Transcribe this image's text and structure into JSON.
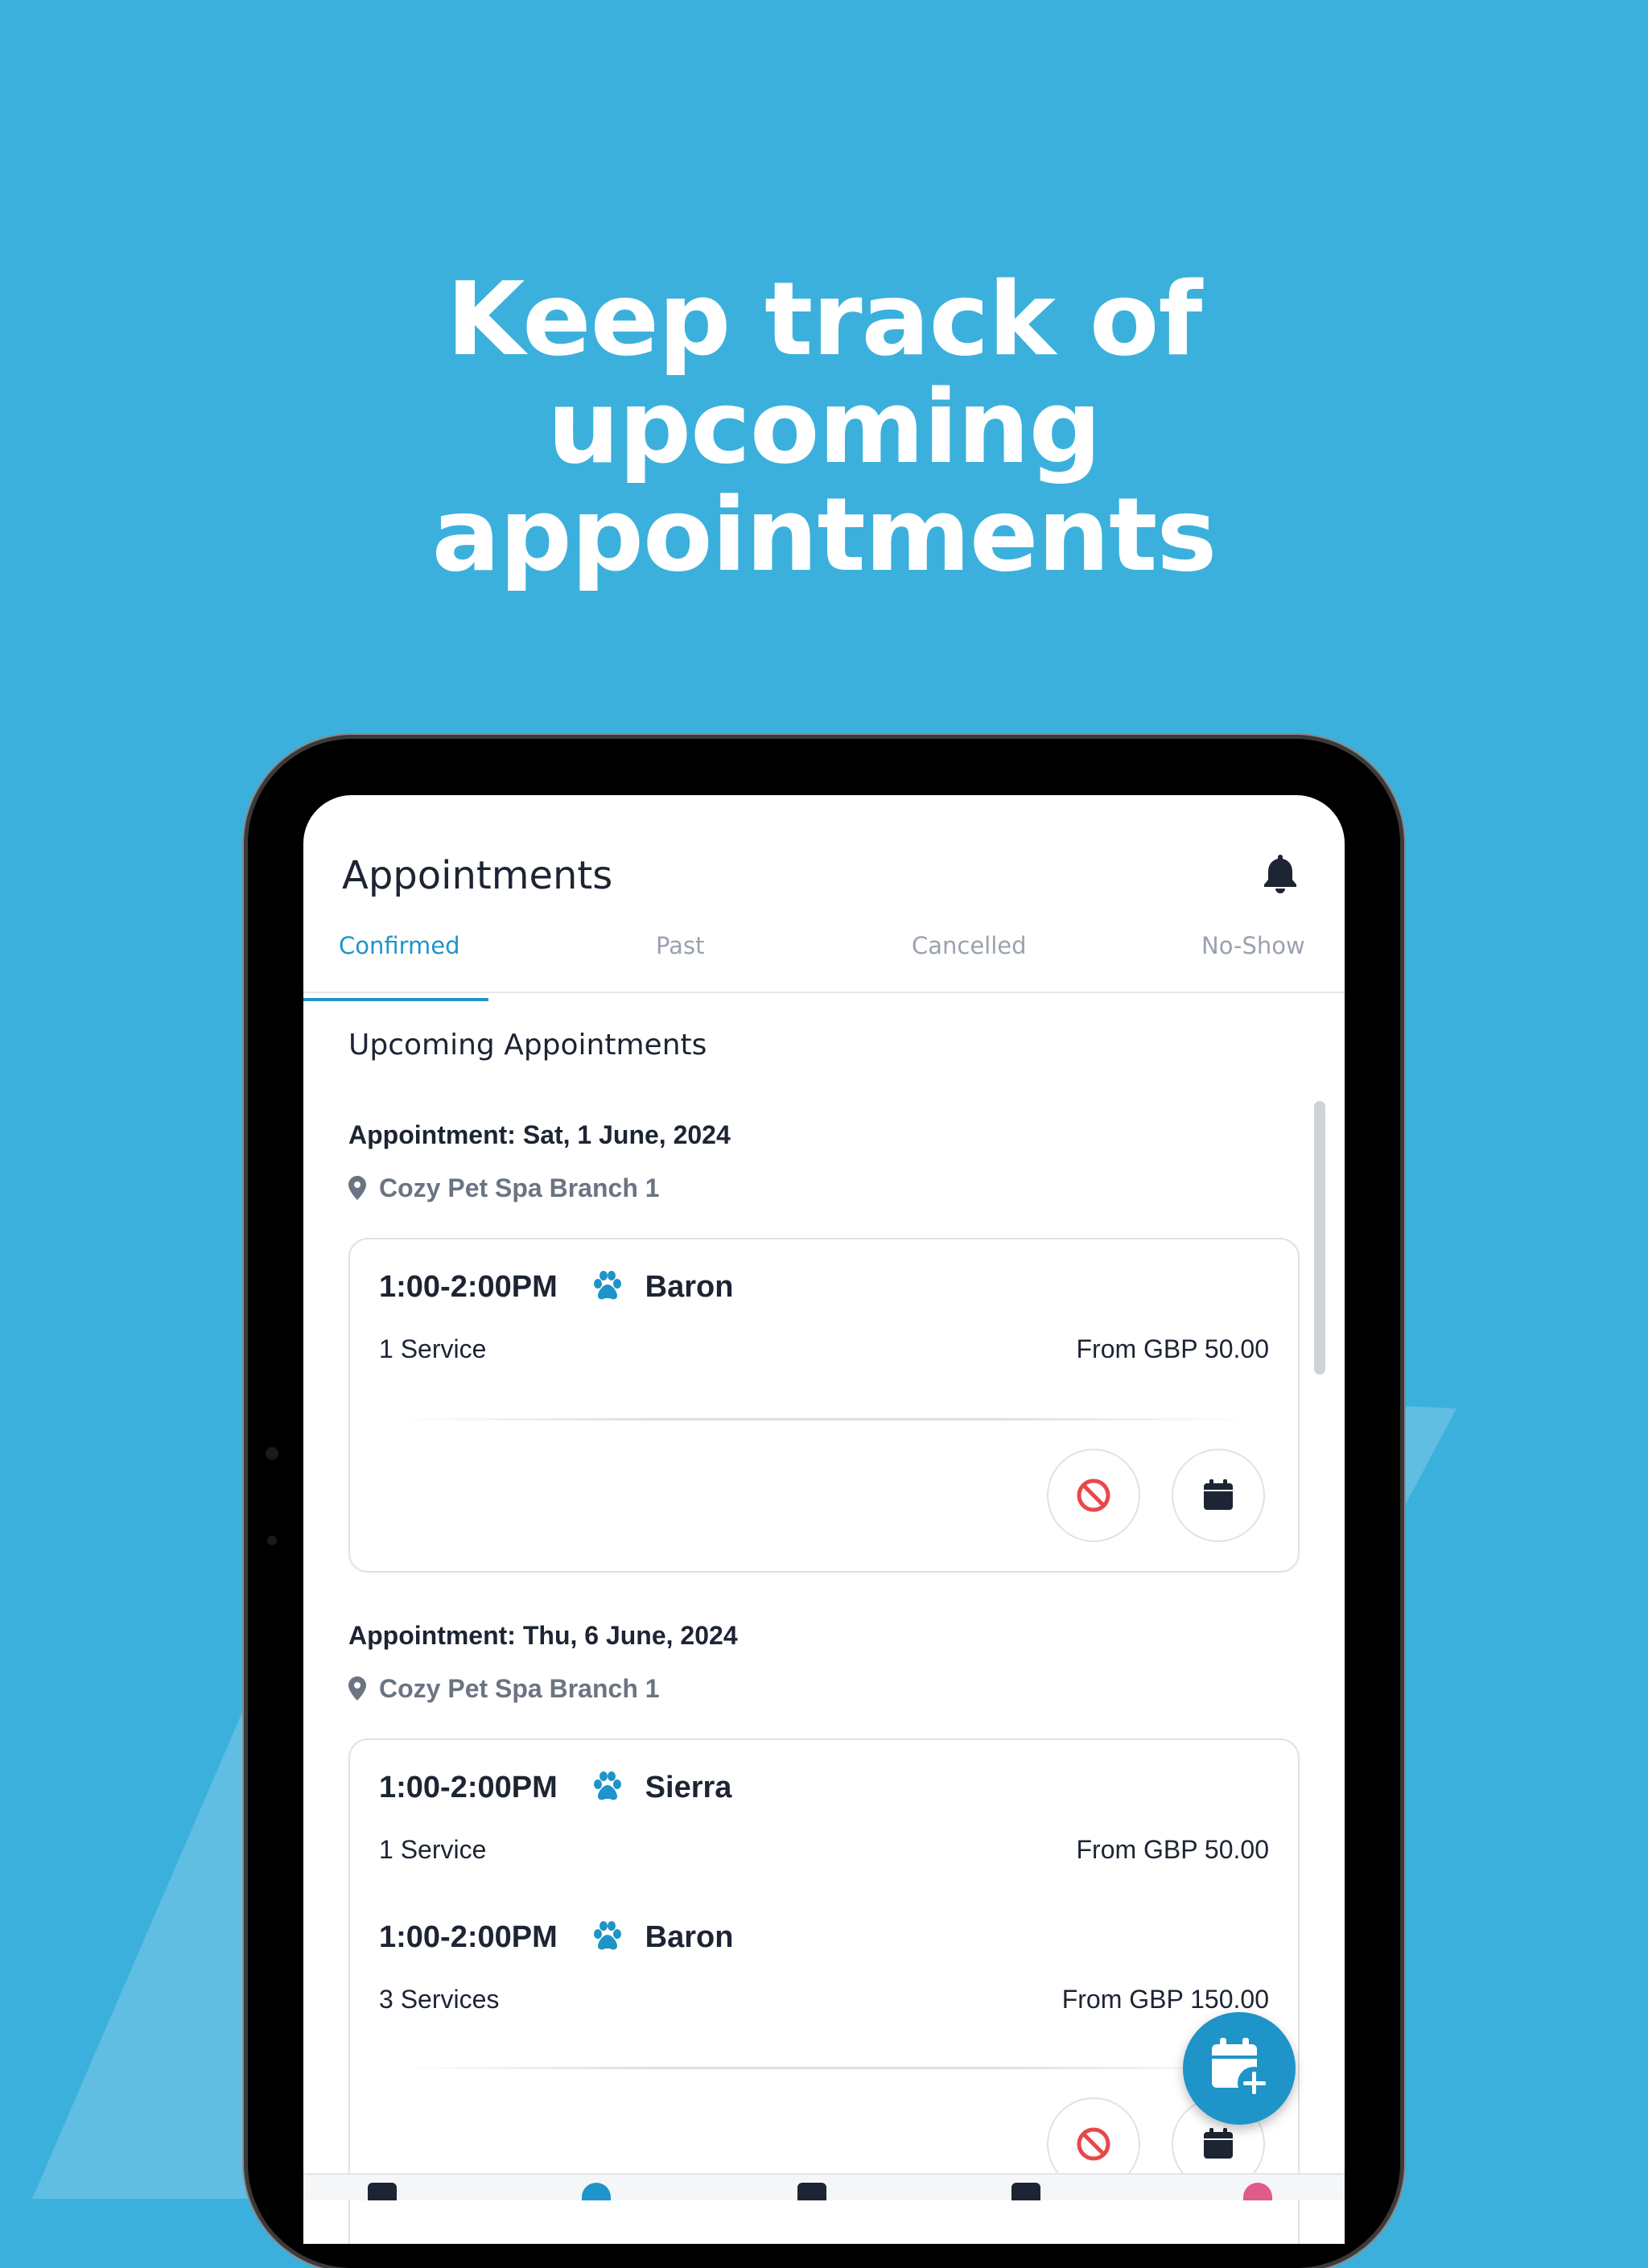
{
  "headline": {
    "line1": "Keep track of",
    "line2": "upcoming",
    "line3": "appointments"
  },
  "app": {
    "title": "Appointments",
    "tabs": [
      {
        "label": "Confirmed",
        "active": true
      },
      {
        "label": "Past",
        "active": false
      },
      {
        "label": "Cancelled",
        "active": false
      },
      {
        "label": "No-Show",
        "active": false
      }
    ],
    "section_title": "Upcoming Appointments",
    "appointments": [
      {
        "date": "Appointment: Sat, 1 June, 2024",
        "location": "Cozy Pet Spa Branch 1",
        "pets": [
          {
            "time": "1:00-2:00PM",
            "name": "Baron",
            "services": "1 Service",
            "price": "From GBP 50.00"
          }
        ]
      },
      {
        "date": "Appointment: Thu, 6 June, 2024",
        "location": "Cozy Pet Spa Branch 1",
        "pets": [
          {
            "time": "1:00-2:00PM",
            "name": "Sierra",
            "services": "1 Service",
            "price": "From GBP 50.00"
          },
          {
            "time": "1:00-2:00PM",
            "name": "Baron",
            "services": "3 Services",
            "price": "From GBP 150.00"
          }
        ]
      }
    ]
  },
  "icons": {
    "bell": "bell-icon",
    "location": "map-pin-icon",
    "paw": "paw-icon",
    "cancel": "ban-icon",
    "reschedule": "calendar-icon",
    "add_appointment": "calendar-plus-icon"
  },
  "colors": {
    "background": "#3cb0dc",
    "accent": "#1f94c8",
    "cancel_red": "#e8474b",
    "text_dark": "#1d2433",
    "text_muted": "#6b7482"
  }
}
